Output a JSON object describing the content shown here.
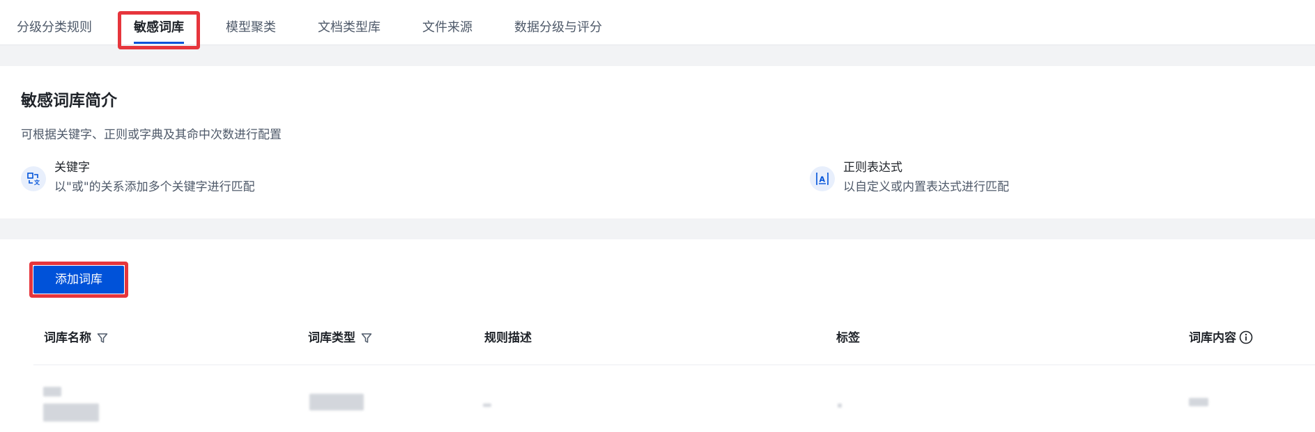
{
  "tabs": [
    {
      "label": "分级分类规则",
      "active": false
    },
    {
      "label": "敏感词库",
      "active": true
    },
    {
      "label": "模型聚类",
      "active": false
    },
    {
      "label": "文档类型库",
      "active": false
    },
    {
      "label": "文件来源",
      "active": false
    },
    {
      "label": "数据分级与评分",
      "active": false
    }
  ],
  "intro": {
    "title": "敏感词库简介",
    "description": "可根据关键字、正则或字典及其命中次数进行配置",
    "features": [
      {
        "icon": "keyword-icon",
        "name": "关键字",
        "description": "以\"或\"的关系添加多个关键字进行匹配"
      },
      {
        "icon": "regex-icon",
        "name": "正则表达式",
        "description": "以自定义或内置表达式进行匹配"
      }
    ]
  },
  "table": {
    "add_button_label": "添加词库",
    "columns": [
      {
        "label": "词库名称",
        "filterable": true
      },
      {
        "label": "词库类型",
        "filterable": true
      },
      {
        "label": "规则描述",
        "filterable": false
      },
      {
        "label": "标签",
        "filterable": false
      },
      {
        "label": "词库内容",
        "info": true
      }
    ]
  },
  "colors": {
    "accent": "#0052d9",
    "annotation": "#e6353c",
    "icon_bg": "#e8effc"
  }
}
